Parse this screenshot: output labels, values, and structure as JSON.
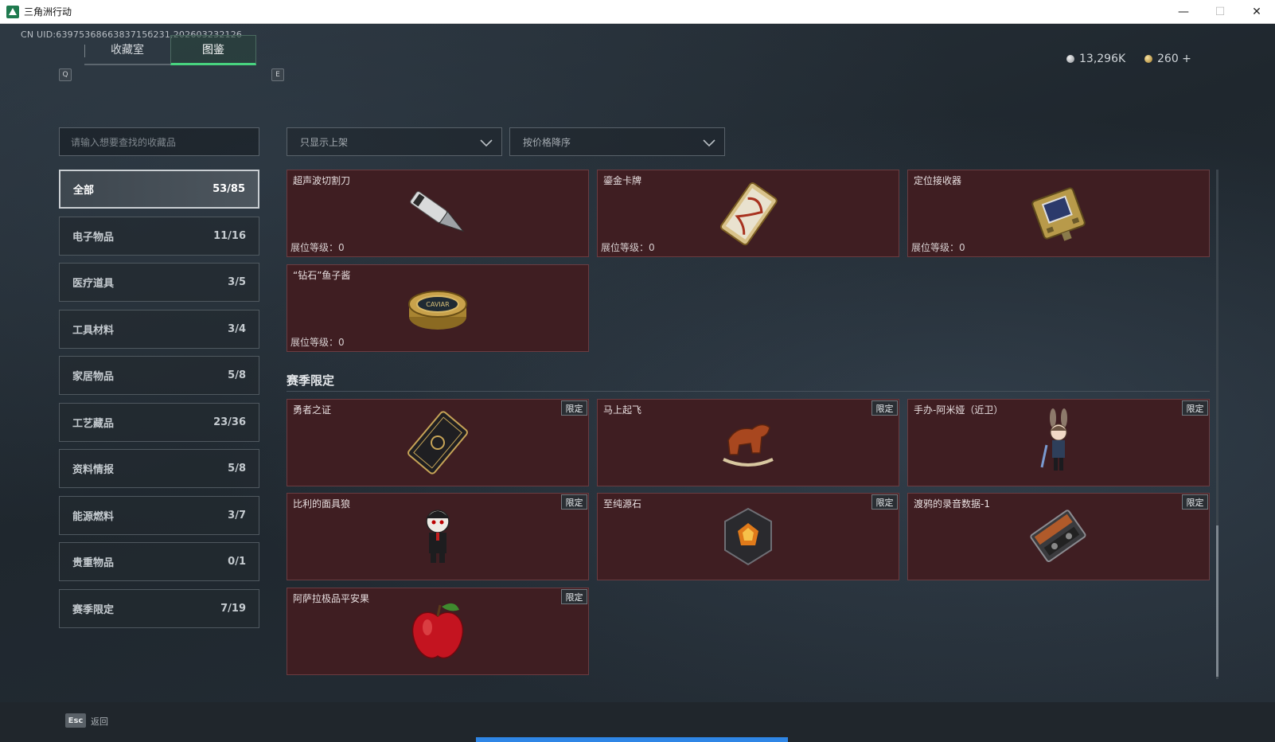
{
  "window": {
    "title": "三角洲行动",
    "minimize": "—",
    "maximize": "☐",
    "close": "✕"
  },
  "header": {
    "uid": "CN UID:6397536866383715б231,202603232126",
    "key_left": "Q",
    "key_right": "E",
    "tabs": [
      {
        "label": "收藏室"
      },
      {
        "label": "图鉴"
      }
    ],
    "currency_silver": "13,296K",
    "currency_gold": "260 +"
  },
  "search": {
    "placeholder": "请输入想要查找的收藏品"
  },
  "filters": {
    "listed_only": "只显示上架",
    "sort": "按价格降序"
  },
  "categories": [
    {
      "label": "全部",
      "count": "53/85"
    },
    {
      "label": "电子物品",
      "count": "11/16"
    },
    {
      "label": "医疗道具",
      "count": "3/5"
    },
    {
      "label": "工具材料",
      "count": "3/4"
    },
    {
      "label": "家居物品",
      "count": "5/8"
    },
    {
      "label": "工艺藏品",
      "count": "23/36"
    },
    {
      "label": "资料情报",
      "count": "5/8"
    },
    {
      "label": "能源燃料",
      "count": "3/7"
    },
    {
      "label": "贵重物品",
      "count": "0/1"
    },
    {
      "label": "赛季限定",
      "count": "7/19"
    }
  ],
  "items": [
    {
      "name": "超声波切割刀",
      "level": "展位等级：0",
      "icon": "ultrasonic-knife-icon"
    },
    {
      "name": "鎏金卡牌",
      "level": "展位等级：0",
      "icon": "gilded-card-icon"
    },
    {
      "name": "定位接收器",
      "level": "展位等级：0",
      "icon": "locator-receiver-icon"
    },
    {
      "name": "“钻石”鱼子酱",
      "level": "展位等级：0",
      "icon": "caviar-tin-icon",
      "tin_label": "CAVIAR"
    }
  ],
  "season": {
    "title": "赛季限定",
    "tag": "限定",
    "items": [
      {
        "name": "勇者之证",
        "icon": "hero-card-icon"
      },
      {
        "name": "马上起飞",
        "icon": "rocking-horse-icon"
      },
      {
        "name": "手办-阿米娅（近卫）",
        "icon": "amiya-figure-icon"
      },
      {
        "name": "比利的面具狼",
        "icon": "billy-puppet-icon"
      },
      {
        "name": "至纯源石",
        "icon": "originium-icon"
      },
      {
        "name": "渡鸦的录音数据-1",
        "icon": "tape-recorder-icon"
      },
      {
        "name": "阿萨拉极品平安果",
        "icon": "red-apple-icon"
      }
    ]
  },
  "footer": {
    "esc": "Esc",
    "back": "返回"
  },
  "loading_progress": 1.0,
  "colors": {
    "accent": "#48d37f",
    "card_bg": "#3f1e22",
    "progress": "#2f86e6"
  }
}
